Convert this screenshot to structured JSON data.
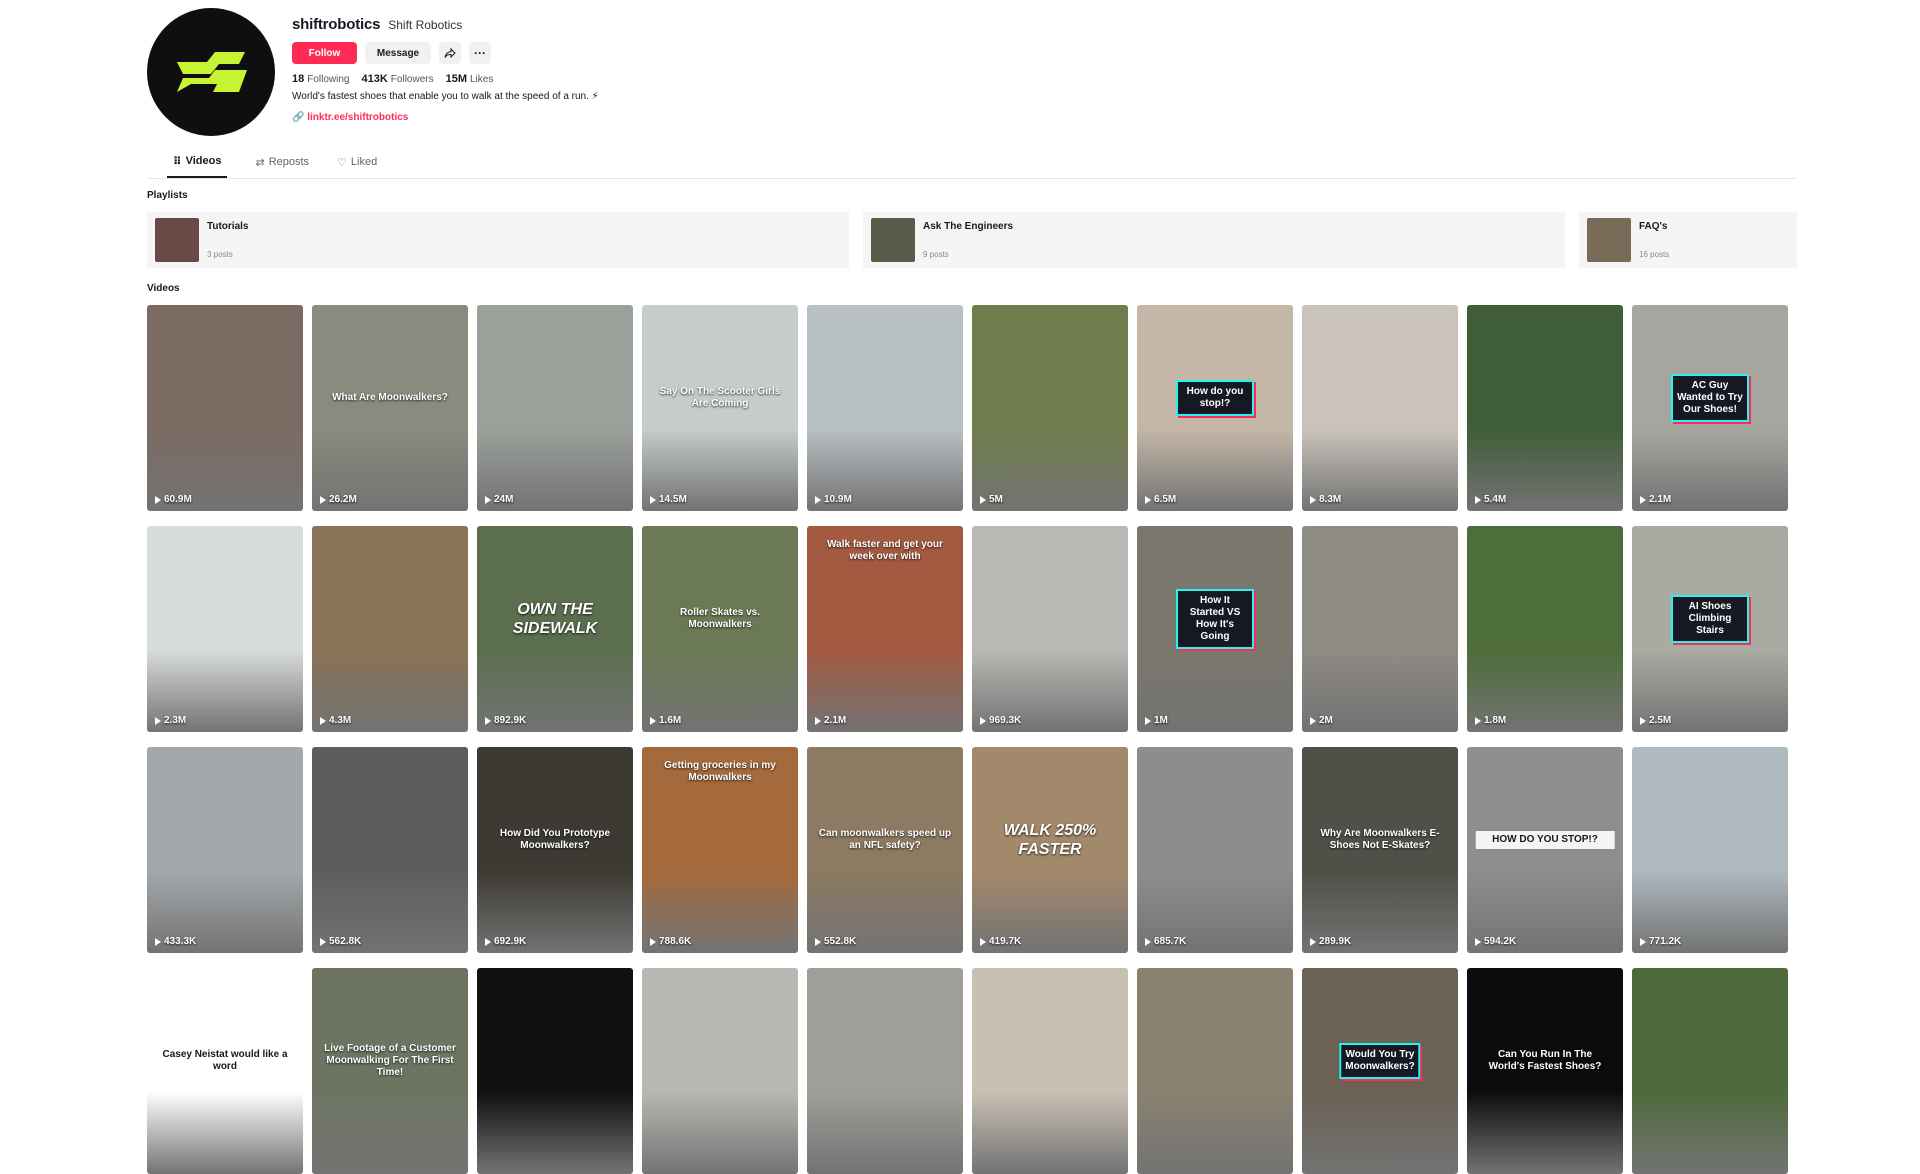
{
  "profile": {
    "username": "shiftrobotics",
    "nickname": "Shift Robotics",
    "follow_label": "Follow",
    "message_label": "Message",
    "share_icon": "share-icon",
    "more_label": "···",
    "stats": {
      "following_count": "18",
      "following_label": "Following",
      "followers_count": "413K",
      "followers_label": "Followers",
      "likes_count": "15M",
      "likes_label": "Likes"
    },
    "bio": "World's fastest shoes that enable you to walk at the speed of a run. ⚡",
    "link": "linktr.ee/shiftrobotics",
    "colors": {
      "follow": "#fe2c55",
      "avatar_bg": "#0f0f0f",
      "logo": "#c6f432"
    }
  },
  "tabs": [
    {
      "label": "Videos",
      "icon": "grid-icon",
      "glyph": "⠿"
    },
    {
      "label": "Reposts",
      "icon": "repost-icon",
      "glyph": "⇄"
    },
    {
      "label": "Liked",
      "icon": "heart-icon",
      "glyph": "♡"
    }
  ],
  "playlists_label": "Playlists",
  "playlists": [
    {
      "title": "Tutorials",
      "count": "3 posts"
    },
    {
      "title": "Ask The Engineers",
      "count": "9 posts"
    },
    {
      "title": "FAQ's",
      "count": "16 posts"
    }
  ],
  "videos_label": "Videos",
  "videos": [
    {
      "views": "60.9M",
      "caption": "",
      "bg": "#7c6b63"
    },
    {
      "views": "26.2M",
      "caption": "What Are Moonwalkers?",
      "bg": "#8a8a7e"
    },
    {
      "views": "24M",
      "caption": "",
      "bg": "#9aa09a"
    },
    {
      "views": "14.5M",
      "caption": "Say On The Scooter Girls Are Coming",
      "bg": "#c5ccc9"
    },
    {
      "views": "10.9M",
      "caption": "",
      "bg": "#b9c0c4"
    },
    {
      "views": "5M",
      "caption": "",
      "bg": "#6f7d4c"
    },
    {
      "views": "6.5M",
      "caption": "How do you stop!?",
      "bg": "#c4b7a8",
      "style": "boxed"
    },
    {
      "views": "8.3M",
      "caption": "",
      "bg": "#c9c3ba"
    },
    {
      "views": "5.4M",
      "caption": "",
      "bg": "#3f5e38"
    },
    {
      "views": "2.1M",
      "caption": "AC Guy Wanted to Try Our Shoes!",
      "bg": "#a6a5a0",
      "style": "boxed"
    },
    {
      "views": "2.3M",
      "caption": "",
      "bg": "#d9ddd9"
    },
    {
      "views": "4.3M",
      "caption": "",
      "bg": "#8a7256"
    },
    {
      "views": "892.9K",
      "caption": "OWN THE SIDEWALK",
      "bg": "#5b6f4f",
      "style": "big"
    },
    {
      "views": "1.6M",
      "caption": "Roller Skates vs. Moonwalkers",
      "bg": "#6b7a55"
    },
    {
      "views": "2.1M",
      "caption": "Walk faster and get your week over with",
      "bg": "#a45a40",
      "style": "top"
    },
    {
      "views": "969.3K",
      "caption": "",
      "bg": "#b9b8b4"
    },
    {
      "views": "1M",
      "caption": "How It Started VS How It's Going",
      "bg": "#7a776c",
      "style": "boxed"
    },
    {
      "views": "2M",
      "caption": "",
      "bg": "#8f8b85"
    },
    {
      "views": "1.8M",
      "caption": "",
      "bg": "#4d6d3a"
    },
    {
      "views": "2.5M",
      "caption": "AI Shoes Climbing Stairs",
      "bg": "#a9aba2",
      "style": "boxed"
    },
    {
      "views": "433.3K",
      "caption": "",
      "bg": "#a4a8ab"
    },
    {
      "views": "562.8K",
      "caption": "",
      "bg": "#5c5d5e"
    },
    {
      "views": "692.9K",
      "caption": "How Did You Prototype Moonwalkers?",
      "bg": "#3d3a33"
    },
    {
      "views": "788.6K",
      "caption": "Getting groceries in my Moonwalkers",
      "bg": "#a46a3c",
      "style": "top"
    },
    {
      "views": "552.8K",
      "caption": "Can moonwalkers speed up an NFL safety?",
      "bg": "#8c7a62"
    },
    {
      "views": "419.7K",
      "caption": "WALK 250% FASTER",
      "bg": "#a3896c",
      "style": "big"
    },
    {
      "views": "685.7K",
      "caption": "",
      "bg": "#8c8e8d"
    },
    {
      "views": "289.9K",
      "caption": "Why Are Moonwalkers E-Shoes Not E-Skates?",
      "bg": "#4f5148"
    },
    {
      "views": "594.2K",
      "caption": "HOW DO YOU STOP!?",
      "bg": "#8d8f8d",
      "style": "dark"
    },
    {
      "views": "771.2K",
      "caption": "",
      "bg": "#aeb9c0"
    },
    {
      "views": "",
      "caption": "Casey Neistat would like a word",
      "bg": "#ffffff",
      "style": "dark"
    },
    {
      "views": "",
      "caption": "Live Footage of a Customer Moonwalking For The First Time!",
      "bg": "#6d7562"
    },
    {
      "views": "",
      "caption": "",
      "bg": "#111111"
    },
    {
      "views": "",
      "caption": "",
      "bg": "#b8b8b2"
    },
    {
      "views": "",
      "caption": "",
      "bg": "#a09e98"
    },
    {
      "views": "",
      "caption": "",
      "bg": "#c9c0b4"
    },
    {
      "views": "",
      "caption": "",
      "bg": "#8a8270"
    },
    {
      "views": "",
      "caption": "Would You Try Moonwalkers?",
      "bg": "#6b6155",
      "style": "boxed"
    },
    {
      "views": "",
      "caption": "Can You Run In The World's Fastest Shoes?",
      "bg": "#0c0c0c"
    },
    {
      "views": "",
      "caption": "",
      "bg": "#4f6b3c"
    }
  ]
}
